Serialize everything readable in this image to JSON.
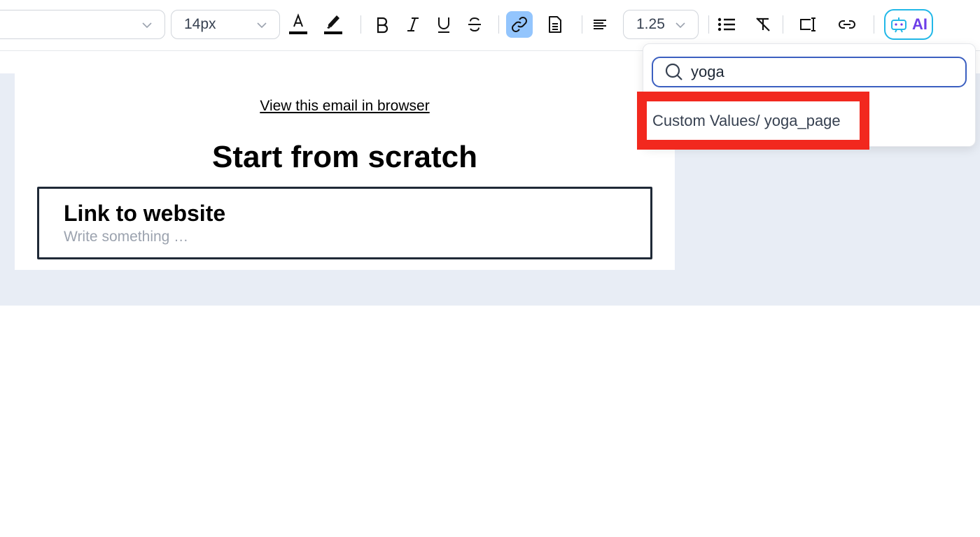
{
  "toolbar": {
    "font_size": "14px",
    "line_height": "1.25",
    "ai_label": "AI",
    "accent_active": "#93c5fd",
    "icons": [
      "chevron-down-icon",
      "text-color-icon",
      "highlight-icon",
      "bold-icon",
      "italic-icon",
      "underline-icon",
      "strikethrough-icon",
      "link-icon",
      "document-icon",
      "align-left-icon",
      "bullet-list-icon",
      "clear-format-icon",
      "text-field-icon",
      "chain-link-icon",
      "ai-robot-icon"
    ]
  },
  "email": {
    "view_link": "View this email in browser",
    "heading": "Start from scratch",
    "block_title": "Link to website",
    "block_placeholder": "Write something …"
  },
  "dropdown": {
    "search_value": "yoga",
    "results": [
      {
        "label": "Custom Values/ yoga_page",
        "highlighted": true
      }
    ],
    "highlight_color": "#f2281e"
  }
}
